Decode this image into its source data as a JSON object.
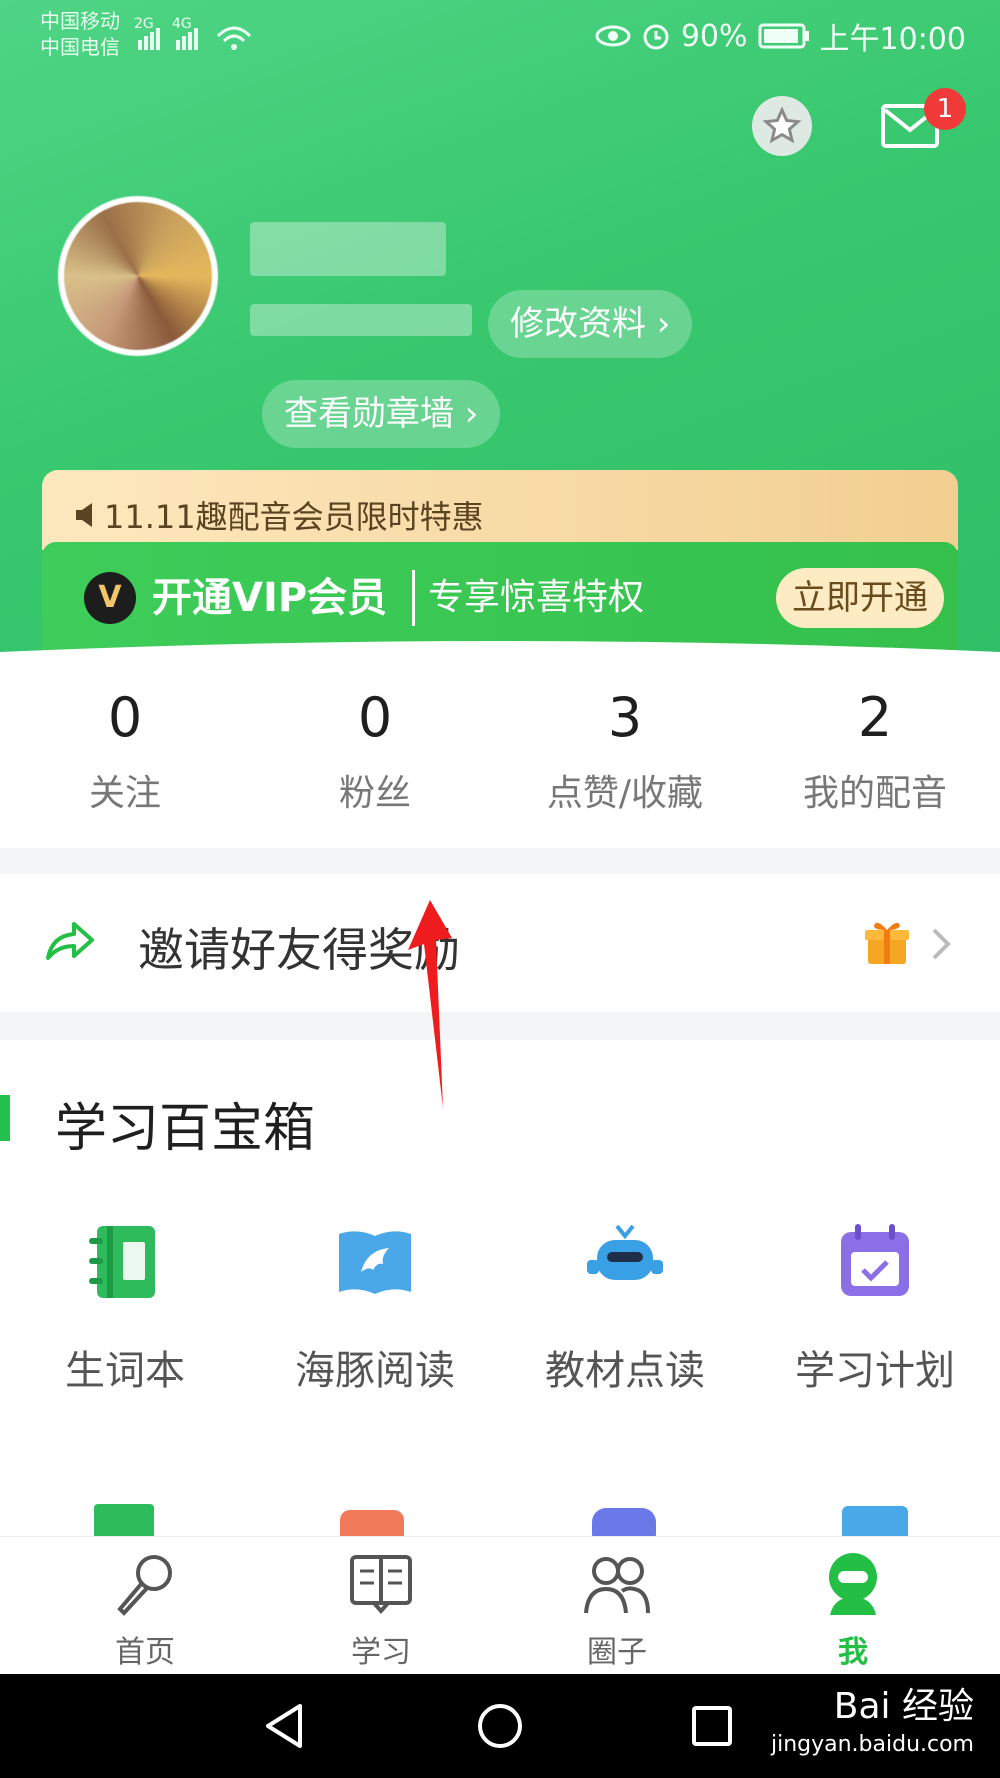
{
  "status_bar": {
    "carrier_1": "中国移动",
    "carrier_2": "中国电信",
    "net_1": "2G",
    "net_2": "4G",
    "battery": "90%",
    "time": "上午10:00"
  },
  "header": {
    "mail_badge": "1",
    "edit_profile": "修改资料 ›",
    "badge_wall": "查看勋章墙 ›"
  },
  "promo": {
    "text": "11.11趣配音会员限时特惠",
    "vip_logo": "V",
    "vip_title": "开通VIP会员",
    "vip_subtitle": "专享惊喜特权",
    "vip_button": "立即开通"
  },
  "stats": [
    {
      "value": "0",
      "label": "关注"
    },
    {
      "value": "0",
      "label": "粉丝"
    },
    {
      "value": "3",
      "label": "点赞/收藏"
    },
    {
      "value": "2",
      "label": "我的配音"
    }
  ],
  "invite": {
    "label": "邀请好友得奖励"
  },
  "toolbox": {
    "title": "学习百宝箱",
    "items": [
      {
        "label": "生词本",
        "icon": "notebook-icon",
        "color": "#2dbb5c"
      },
      {
        "label": "海豚阅读",
        "icon": "dolphin-book-icon",
        "color": "#4aa8e8"
      },
      {
        "label": "教材点读",
        "icon": "robot-icon",
        "color": "#3aa0e6"
      },
      {
        "label": "学习计划",
        "icon": "calendar-icon",
        "color": "#8a6fe6"
      }
    ]
  },
  "bottom_nav": [
    {
      "label": "首页",
      "icon": "microphone-icon"
    },
    {
      "label": "学习",
      "icon": "book-icon"
    },
    {
      "label": "圈子",
      "icon": "people-icon"
    },
    {
      "label": "我",
      "icon": "user-icon",
      "active": true
    }
  ],
  "watermark": {
    "brand": "Bai 经验",
    "url": "jingyan.baidu.com"
  },
  "colors": {
    "header_green": "#39c86f",
    "vip_green": "#3ecd5a",
    "accent_green": "#22bf44",
    "badge_red": "#f03a3a"
  }
}
